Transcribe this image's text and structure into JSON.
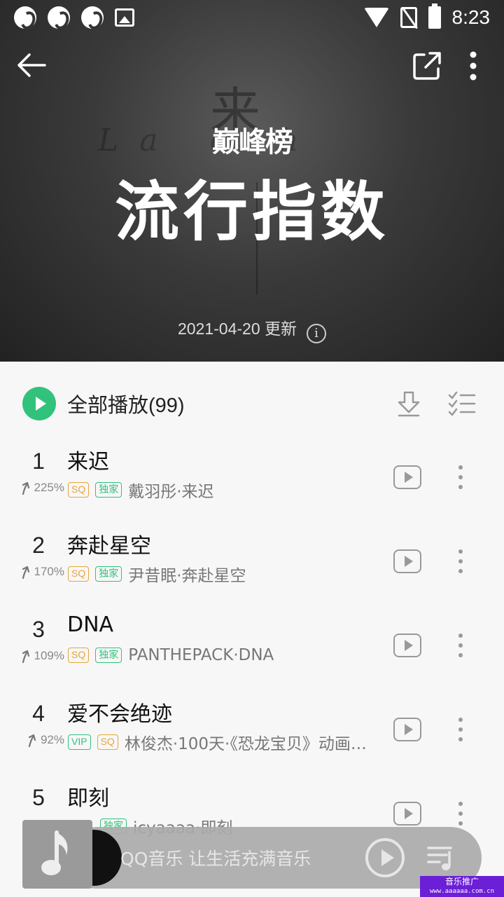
{
  "status_bar": {
    "time": "8:23"
  },
  "header": {
    "logo_text": "巅峰榜",
    "title": "流行指数",
    "update_text": "2021-04-20 更新",
    "info_glyph": "i"
  },
  "hero_bg": {
    "glyph": "来",
    "script": "La c h"
  },
  "play_all": {
    "label": "全部播放(99)"
  },
  "songs": [
    {
      "rank": "1",
      "title": "来迟",
      "trend": "225%",
      "tags": [
        "SQ",
        "独家"
      ],
      "artist": "戴羽彤·来迟"
    },
    {
      "rank": "2",
      "title": "奔赴星空",
      "trend": "170%",
      "tags": [
        "SQ",
        "独家"
      ],
      "artist": "尹昔眠·奔赴星空"
    },
    {
      "rank": "3",
      "title": "DNA",
      "trend": "109%",
      "tags": [
        "SQ",
        "独家"
      ],
      "artist": "PANTHEPACK·DNA"
    },
    {
      "rank": "4",
      "title": "爱不会绝迹",
      "trend": "92%",
      "tags": [
        "VIP",
        "SQ"
      ],
      "artist": "林俊杰·100天·《恐龙宝贝》动画…"
    },
    {
      "rank": "5",
      "title": "即刻",
      "trend": "",
      "tags": [
        "",
        "独家"
      ],
      "artist": "icyaaaa·即刻"
    }
  ],
  "mini_player": {
    "text": "QQ音乐 让生活充满音乐"
  },
  "promo": {
    "label": "音乐推广",
    "url": "www.aaaaaa.com.cn"
  },
  "colors": {
    "accent": "#31c27c",
    "sq": "#e8a53a",
    "promo": "#6b1fd6"
  }
}
